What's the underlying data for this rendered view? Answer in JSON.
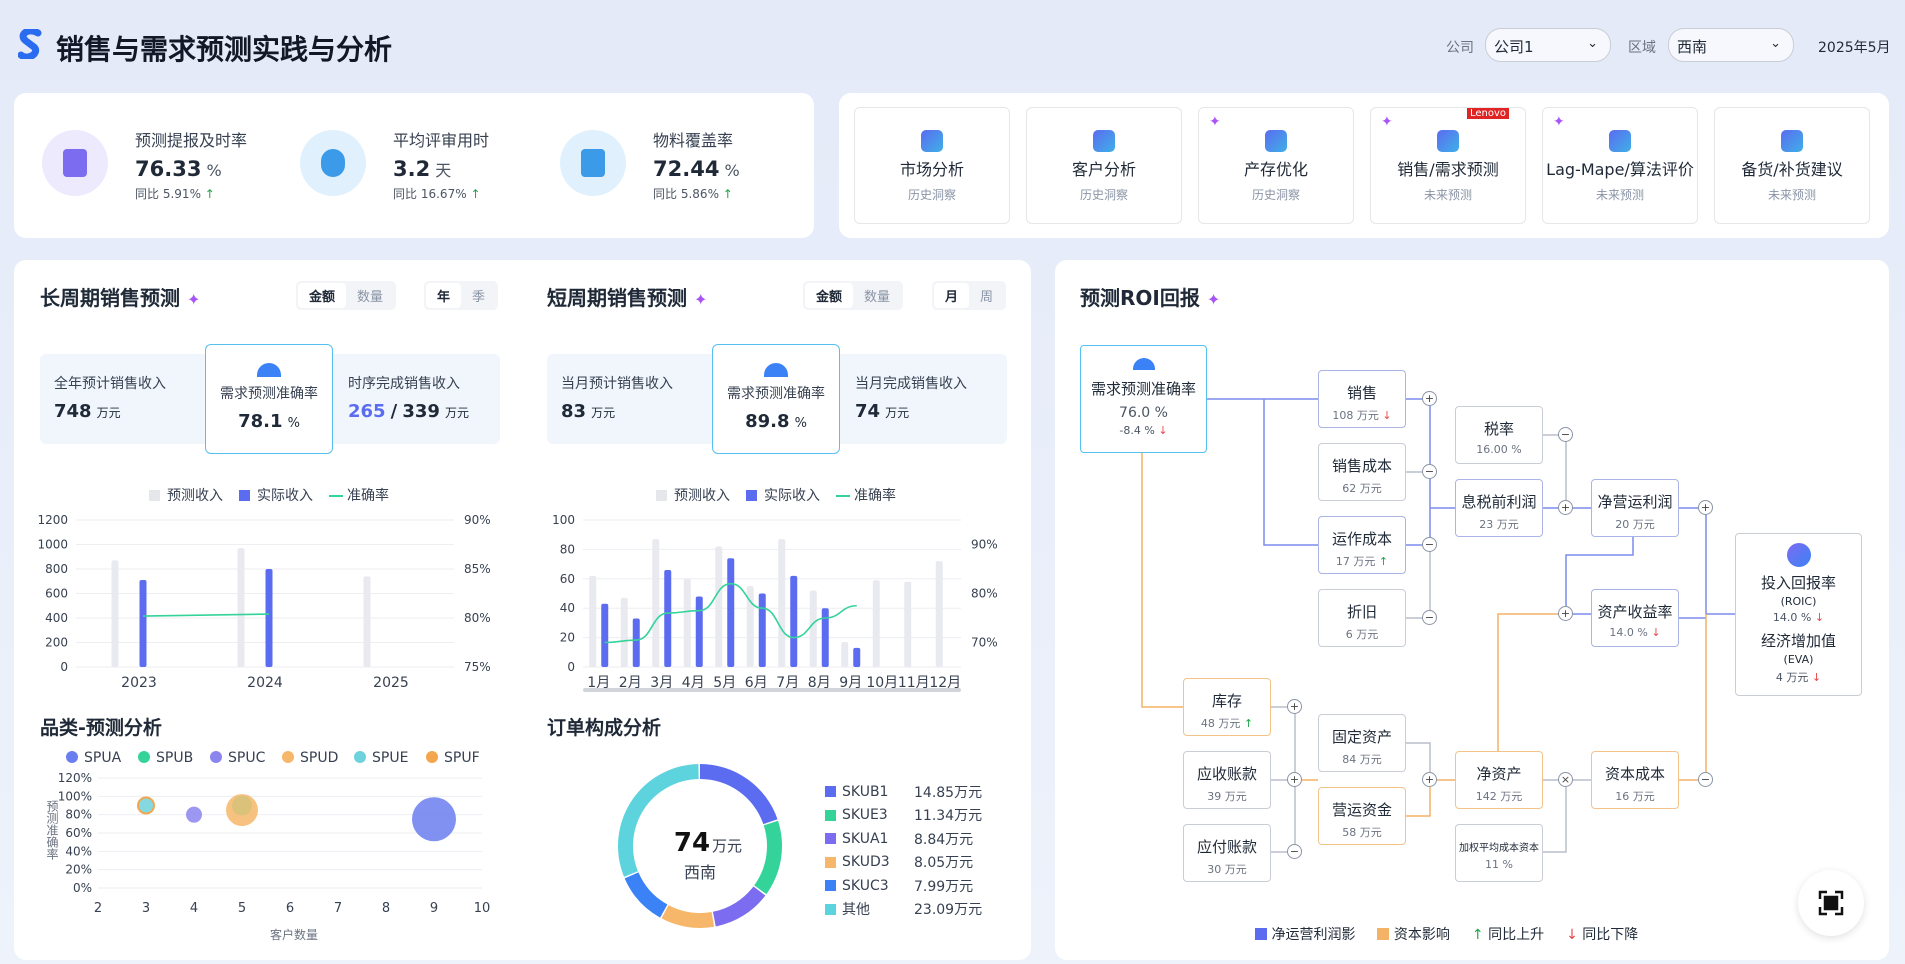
{
  "header": {
    "title": "销售与需求预测实践与分析",
    "company_label": "公司",
    "company_value": "公司1",
    "region_label": "区域",
    "region_value": "西南",
    "date": "2025年5月"
  },
  "kpis": [
    {
      "label": "预测提报及时率",
      "value": "76.33",
      "unit": "%",
      "yoy_label": "同比",
      "yoy": "5.91%",
      "dir": "up",
      "icon": "clipboard-check-icon",
      "color": "#7c6cf0",
      "bg": "#eeeafe"
    },
    {
      "label": "平均评审用时",
      "value": "3.2",
      "unit": "天",
      "yoy_label": "同比",
      "yoy": "16.67%",
      "dir": "up",
      "icon": "clock-icon",
      "color": "#3b9be8",
      "bg": "#e0f1fd"
    },
    {
      "label": "物料覆盖率",
      "value": "72.44",
      "unit": "%",
      "yoy_label": "同比",
      "yoy": "5.86%",
      "dir": "up",
      "icon": "archive-box-icon",
      "color": "#3b9be8",
      "bg": "#e0f1fd"
    }
  ],
  "tiles": [
    {
      "name": "市场分析",
      "sub": "历史洞察",
      "icon": "presentation-chart-icon",
      "spark": false,
      "badge": ""
    },
    {
      "name": "客户分析",
      "sub": "历史洞察",
      "icon": "user-icon",
      "spark": false,
      "badge": ""
    },
    {
      "name": "产存优化",
      "sub": "历史洞察",
      "icon": "warehouse-icon",
      "spark": true,
      "badge": ""
    },
    {
      "name": "销售/需求预测",
      "sub": "未来预测",
      "icon": "bar-chart-icon",
      "spark": true,
      "badge": "Lenovo"
    },
    {
      "name": "Lag-Mape/算法评价",
      "sub": "未来预测",
      "icon": "clipboard-list-icon",
      "spark": true,
      "badge": ""
    },
    {
      "name": "备货/补货建议",
      "sub": "未来预测",
      "icon": "cart-icon",
      "spark": false,
      "badge": ""
    }
  ],
  "long": {
    "title": "长周期销售预测",
    "seg1": [
      "金额",
      "数量"
    ],
    "seg2": [
      "年",
      "季"
    ],
    "s1_label": "全年预计销售收入",
    "s1_value": "748",
    "s1_unit": "万元",
    "mid_label": "需求预测准确率",
    "mid_value": "78.1",
    "mid_unit": "%",
    "s3_label": "时序完成销售收入",
    "s3_done": "265",
    "s3_sep": "/",
    "s3_total": "339",
    "s3_unit": "万元"
  },
  "short": {
    "title": "短周期销售预测",
    "seg1": [
      "金额",
      "数量"
    ],
    "seg2": [
      "月",
      "周"
    ],
    "s1_label": "当月预计销售收入",
    "s1_value": "83",
    "s1_unit": "万元",
    "mid_label": "需求预测准确率",
    "mid_value": "89.8",
    "mid_unit": "%",
    "s3_label": "当月完成销售收入",
    "s3_value": "74",
    "s3_unit": "万元"
  },
  "legend_common": [
    "预测收入",
    "实际收入",
    "准确率"
  ],
  "chart_data": [
    {
      "type": "bar",
      "id": "long-cycle",
      "categories": [
        "2023",
        "2024",
        "2025"
      ],
      "series": [
        {
          "name": "预测收入",
          "values": [
            870,
            970,
            740
          ]
        },
        {
          "name": "实际收入",
          "values": [
            710,
            800,
            null
          ]
        },
        {
          "name": "准确率",
          "type": "line",
          "values": [
            80.2,
            80.4,
            null
          ]
        }
      ],
      "ylim": [
        0,
        1200
      ],
      "yticks": [
        "0",
        "200",
        "400",
        "600",
        "800",
        "1000",
        "1200"
      ],
      "y2lim": [
        75,
        90
      ],
      "y2ticks": [
        "75%",
        "80%",
        "85%",
        "90%"
      ]
    },
    {
      "type": "bar",
      "id": "short-cycle",
      "categories": [
        "1月",
        "2月",
        "3月",
        "4月",
        "5月",
        "6月",
        "7月",
        "8月",
        "9月",
        "10月",
        "11月",
        "12月"
      ],
      "series": [
        {
          "name": "预测收入",
          "values": [
            62,
            47,
            87,
            60,
            82,
            55,
            87,
            52,
            17,
            59,
            58,
            72
          ]
        },
        {
          "name": "实际收入",
          "values": [
            43,
            33,
            66,
            48,
            74,
            50,
            62,
            40,
            13,
            null,
            null,
            null
          ]
        },
        {
          "name": "准确率",
          "type": "line",
          "values": [
            70,
            70.5,
            76,
            76.5,
            82,
            77,
            71,
            75,
            77.5,
            null,
            null,
            null
          ]
        }
      ],
      "ylim": [
        0,
        100
      ],
      "yticks": [
        "0",
        "20",
        "40",
        "60",
        "80",
        "100"
      ],
      "y2lim": [
        65,
        95
      ],
      "y2ticks": [
        "70%",
        "80%",
        "90%"
      ]
    },
    {
      "type": "scatter",
      "id": "category-forecast",
      "title": "品类-预测分析",
      "xlabel": "客户数量",
      "ylabel": "预测准确率",
      "series": [
        {
          "name": "SPUA",
          "color": "#6b7ef0"
        },
        {
          "name": "SPUB",
          "color": "#34d399"
        },
        {
          "name": "SPUC",
          "color": "#8b85ee"
        },
        {
          "name": "SPUD",
          "color": "#f6b76a"
        },
        {
          "name": "SPUE",
          "color": "#6ed2dc"
        },
        {
          "name": "SPUF",
          "color": "#f4a64e"
        }
      ],
      "points": [
        {
          "x": 3,
          "y": 90,
          "r": 8,
          "color": "#6ed2dc",
          "ring": "#f4a64e"
        },
        {
          "x": 4,
          "y": 80,
          "r": 8,
          "color": "#8b85ee"
        },
        {
          "x": 5,
          "y": 85,
          "r": 16,
          "color": "#f6b76a"
        },
        {
          "x": 5,
          "y": 90,
          "r": 10,
          "color": "#d6c27a"
        },
        {
          "x": 9,
          "y": 75,
          "r": 22,
          "color": "#6b7ef0"
        }
      ],
      "xlim": [
        2,
        10
      ],
      "xticks": [
        "2",
        "3",
        "4",
        "5",
        "6",
        "7",
        "8",
        "9",
        "10"
      ],
      "ylim": [
        0,
        120
      ],
      "yticks": [
        "0%",
        "20%",
        "40%",
        "60%",
        "80%",
        "100%",
        "120%"
      ]
    },
    {
      "type": "pie",
      "id": "order-composition",
      "title": "订单构成分析",
      "center_value": "74",
      "center_unit": "万元",
      "center_label": "西南",
      "slices": [
        {
          "name": "SKUB1",
          "value": 14.85,
          "label": "14.85万元",
          "color": "#5b6cf0"
        },
        {
          "name": "SKUE3",
          "value": 11.34,
          "label": "11.34万元",
          "color": "#34d399"
        },
        {
          "name": "SKUA1",
          "value": 8.84,
          "label": "8.84万元",
          "color": "#7c6cf0"
        },
        {
          "name": "SKUD3",
          "value": 8.05,
          "label": "8.05万元",
          "color": "#f6b76a"
        },
        {
          "name": "SKUC3",
          "value": 7.99,
          "label": "7.99万元",
          "color": "#3b82f6"
        },
        {
          "name": "其他",
          "value": 23.09,
          "label": "23.09万元",
          "color": "#5dd3dd"
        }
      ]
    }
  ],
  "roi": {
    "title": "预测ROI回报",
    "acc": {
      "name": "需求预测准确率",
      "value": "76.0",
      "unit": "%",
      "chg": "-8.4",
      "chg_unit": "%"
    },
    "nodes": {
      "sales": {
        "name": "销售",
        "value": "108",
        "unit": "万元"
      },
      "cost": {
        "name": "销售成本",
        "value": "62",
        "unit": "万元"
      },
      "opcost": {
        "name": "运作成本",
        "value": "17",
        "unit": "万元"
      },
      "dep": {
        "name": "折旧",
        "value": "6",
        "unit": "万元"
      },
      "tax": {
        "name": "税率",
        "value": "16.00",
        "unit": "%"
      },
      "ebit": {
        "name": "息税前利润",
        "value": "23",
        "unit": "万元"
      },
      "nopat": {
        "name": "净营运利润",
        "value": "20",
        "unit": "万元"
      },
      "roa": {
        "name": "资产收益率",
        "value": "14.0",
        "unit": "%"
      },
      "inv": {
        "name": "库存",
        "value": "48",
        "unit": "万元"
      },
      "ar": {
        "name": "应收账款",
        "value": "39",
        "unit": "万元"
      },
      "ap": {
        "name": "应付账款",
        "value": "30",
        "unit": "万元"
      },
      "fa": {
        "name": "固定资产",
        "value": "84",
        "unit": "万元"
      },
      "wc": {
        "name": "营运资金",
        "value": "58",
        "unit": "万元"
      },
      "na": {
        "name": "净资产",
        "value": "142",
        "unit": "万元"
      },
      "wacc": {
        "name": "加权平均成本资本",
        "value": "11",
        "unit": "%"
      },
      "capcost": {
        "name": "资本成本",
        "value": "16",
        "unit": "万元"
      }
    },
    "result": {
      "roic_name": "投入回报率",
      "roic_sub": "(ROIC)",
      "roic_value": "14.0",
      "roic_unit": "%",
      "eva_name": "经济增加值",
      "eva_sub": "(EVA)",
      "eva_value": "4",
      "eva_unit": "万元"
    },
    "legend": [
      "净运营利润影",
      "资本影响",
      "同比上升",
      "同比下降"
    ]
  },
  "colors": {
    "accent": "#5b6cf0",
    "orange": "#f4b266",
    "up": "#22a34a",
    "down": "#e5484d"
  }
}
